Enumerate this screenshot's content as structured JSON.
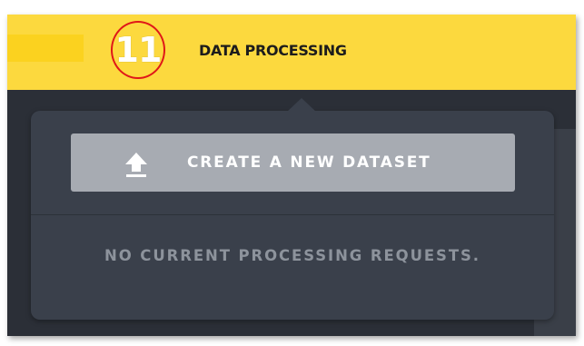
{
  "header": {
    "step_number": "11",
    "title": "DATA PROCESSING"
  },
  "dropdown": {
    "create_button_label": "CREATE A NEW DATASET",
    "create_button_icon": "upload-icon",
    "empty_message": "NO CURRENT PROCESSING REQUESTS."
  },
  "colors": {
    "topbar": "#fcd93e",
    "panel": "#3a404b",
    "button": "#a7abb2",
    "annotation_circle": "#e01818"
  }
}
